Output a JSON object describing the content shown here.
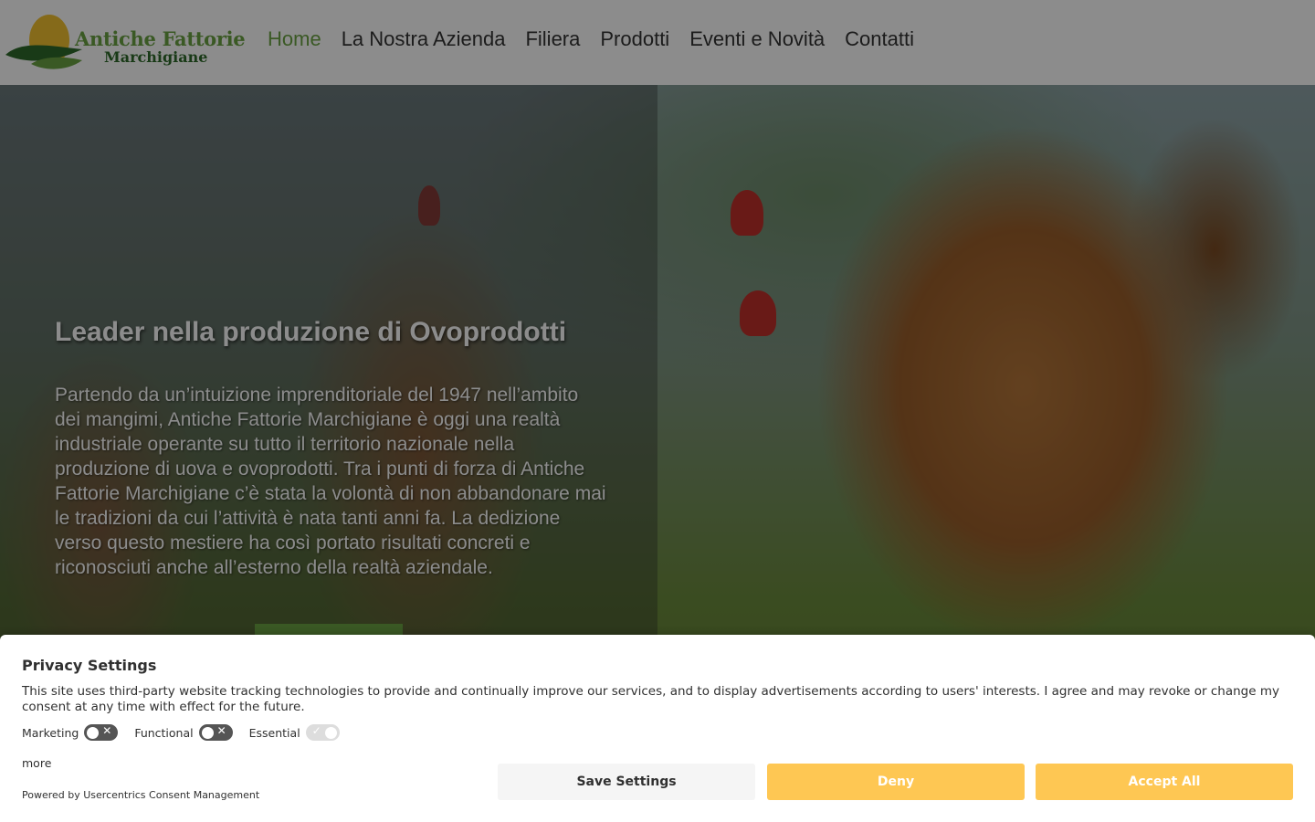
{
  "header": {
    "logo_line1": "Antiche Fattorie",
    "logo_line2": "Marchigiane",
    "nav": [
      {
        "label": "Home"
      },
      {
        "label": "La Nostra Azienda"
      },
      {
        "label": "Filiera"
      },
      {
        "label": "Prodotti"
      },
      {
        "label": "Eventi e Novità"
      },
      {
        "label": "Contatti"
      }
    ]
  },
  "hero": {
    "title": "Leader nella produzione di Ovoprodotti",
    "text": "Partendo da un’intuizione imprenditoriale del 1947 nell’ambito dei mangimi, Antiche Fattorie Marchigiane è oggi una realtà industriale operante su tutto il territorio nazionale nella produzione di uova e ovoprodotti. Tra i punti di forza di Antiche Fattorie Marchigiane c’è stata la volontà di non abbandonare mai le tradizioni da cui l’attività è nata tanti anni fa. La dedizione verso questo mestiere ha così portato risultati concreti e riconosciuti anche all’esterno della realtà aziendale."
  },
  "consent": {
    "title": "Privacy Settings",
    "description": "This site uses third-party website tracking technologies to provide and continually improve our services, and to display advertisements according to users' interests. I agree and may revoke or change my consent at any time with effect for the future.",
    "toggles": [
      {
        "label": "Marketing"
      },
      {
        "label": "Functional"
      },
      {
        "label": "Essential"
      }
    ],
    "more": "more",
    "powered_by": "Powered by Usercentrics Consent Management",
    "buttons": {
      "save": "Save Settings",
      "deny": "Deny",
      "accept": "Accept All"
    },
    "colors": {
      "accent": "#fec753",
      "text": "#303030"
    }
  },
  "brand_colors": {
    "green": "#6aa243",
    "dark_green": "#2f6b2a",
    "yolk": "#f2c230"
  }
}
